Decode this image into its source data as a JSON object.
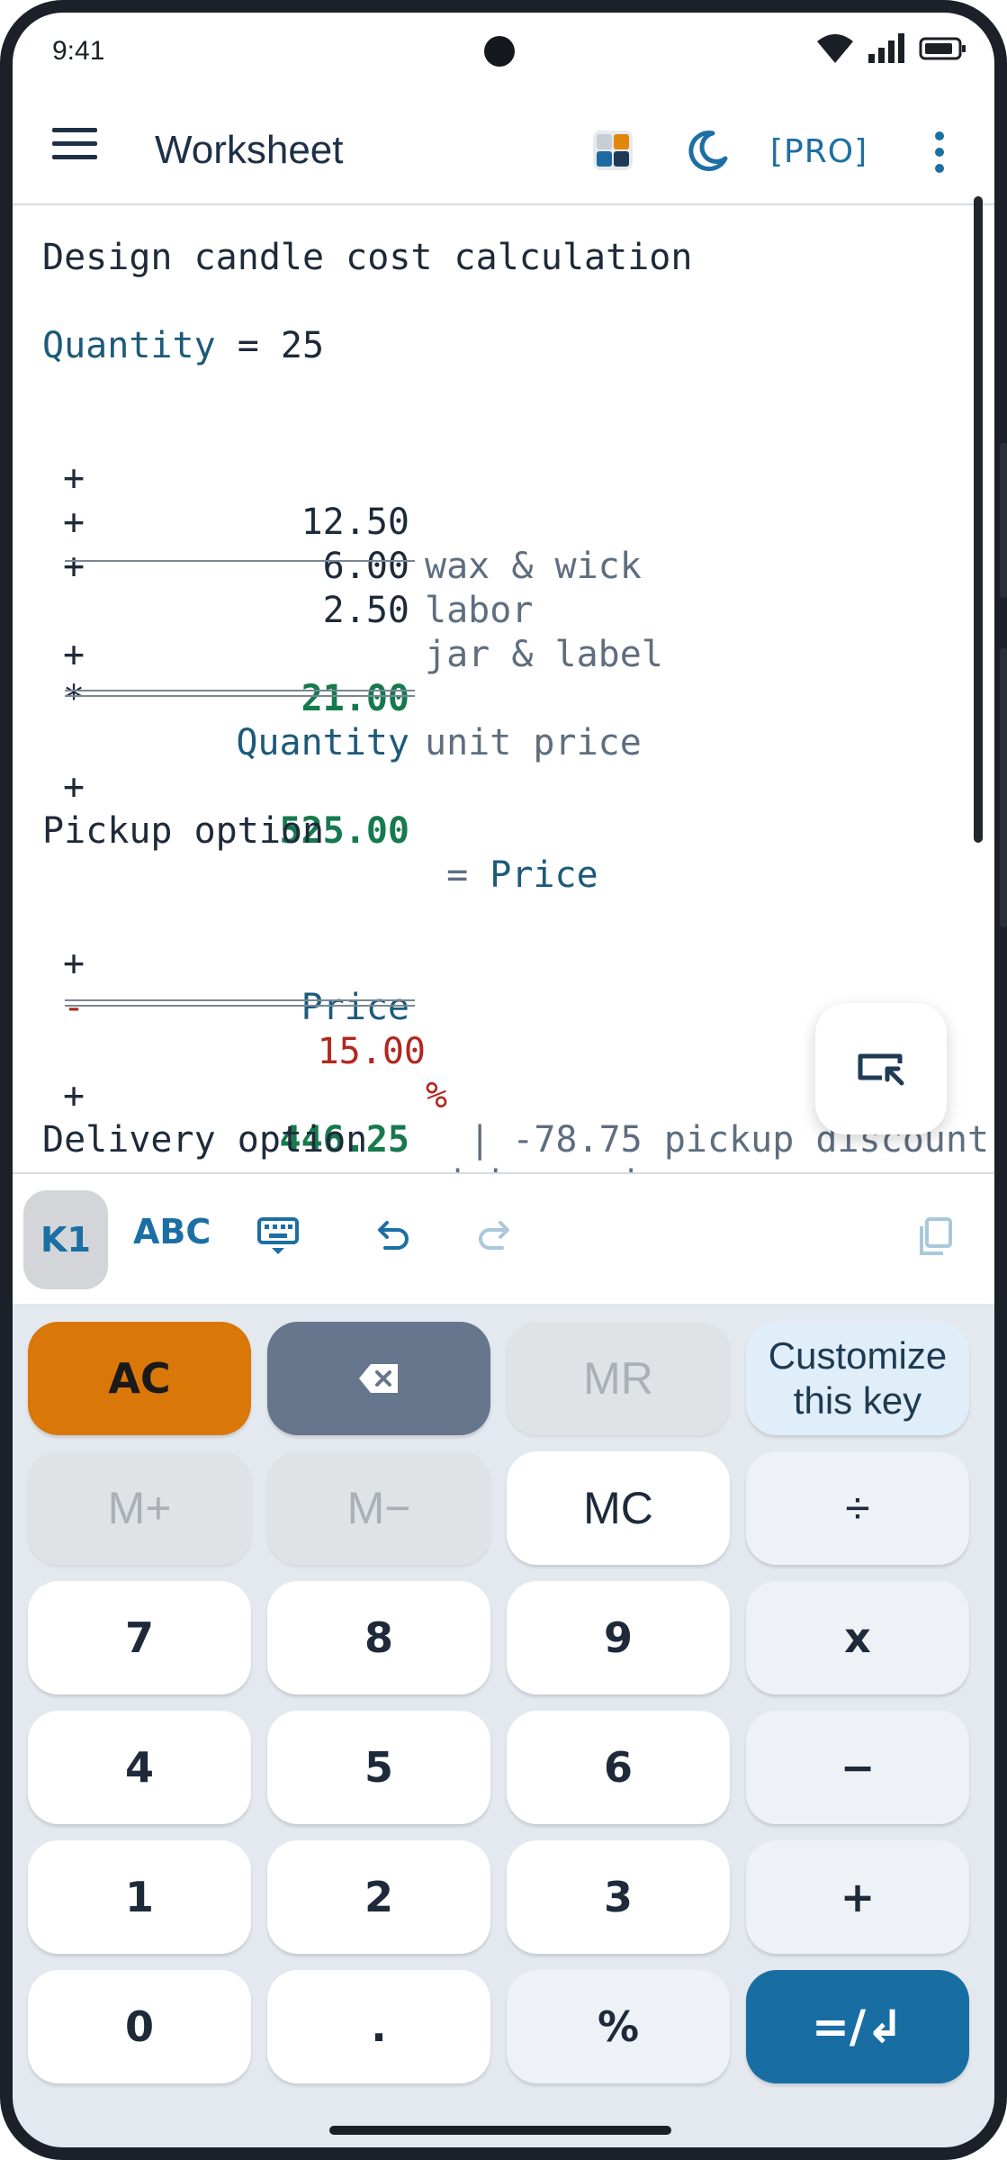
{
  "status_bar": {
    "time": "9:41"
  },
  "app_bar": {
    "title": "Worksheet",
    "pro_label": "[PRO]"
  },
  "colors": {
    "accent": "#1b6fa4",
    "green": "#167a4e",
    "red": "#b3261e",
    "variable": "#1c5a7a",
    "ac_key": "#d97708",
    "equals_key": "#186ea3"
  },
  "worksheet": {
    "heading": "Design candle cost calculation",
    "quantity_name": "Quantity",
    "quantity_rest": " = 25",
    "items": [
      {
        "op": "+",
        "value": "12.50",
        "note": "wax & wick"
      },
      {
        "op": "+",
        "value": "6.00",
        "note": "labor"
      },
      {
        "op": "+",
        "value": "2.50",
        "note": "jar & label"
      }
    ],
    "unit": {
      "op": "+",
      "value": "21.00",
      "note": "unit price"
    },
    "multiply": {
      "op": "*",
      "value": "Quantity"
    },
    "total": {
      "op": "+",
      "value": "525.00",
      "note_eq": " = ",
      "note_var": "Price"
    },
    "pickup_heading": "Pickup option",
    "pickup_base": {
      "op": "+",
      "value": "Price"
    },
    "pickup_discount": {
      "op": "-",
      "value": "15.00",
      "pct": "%",
      "note": " | -78.75 pickup discount"
    },
    "pickup_total": {
      "op": "+",
      "value": "446.25",
      "note": "pickup price"
    },
    "delivery_heading": "Delivery option"
  },
  "toolbar": {
    "k1": "K1",
    "abc": "ABC"
  },
  "keypad": {
    "ac": "AC",
    "mr": "MR",
    "customize_1": "Customize",
    "customize_2": "this key",
    "mplus": "M+",
    "mminus": "M−",
    "mc": "MC",
    "divide": "÷",
    "k7": "7",
    "k8": "8",
    "k9": "9",
    "multiply": "x",
    "k4": "4",
    "k5": "5",
    "k6": "6",
    "minus": "−",
    "k1": "1",
    "k2": "2",
    "k3": "3",
    "plus": "+",
    "k0": "0",
    "dot": ".",
    "percent": "%",
    "equals": "=/↲"
  }
}
